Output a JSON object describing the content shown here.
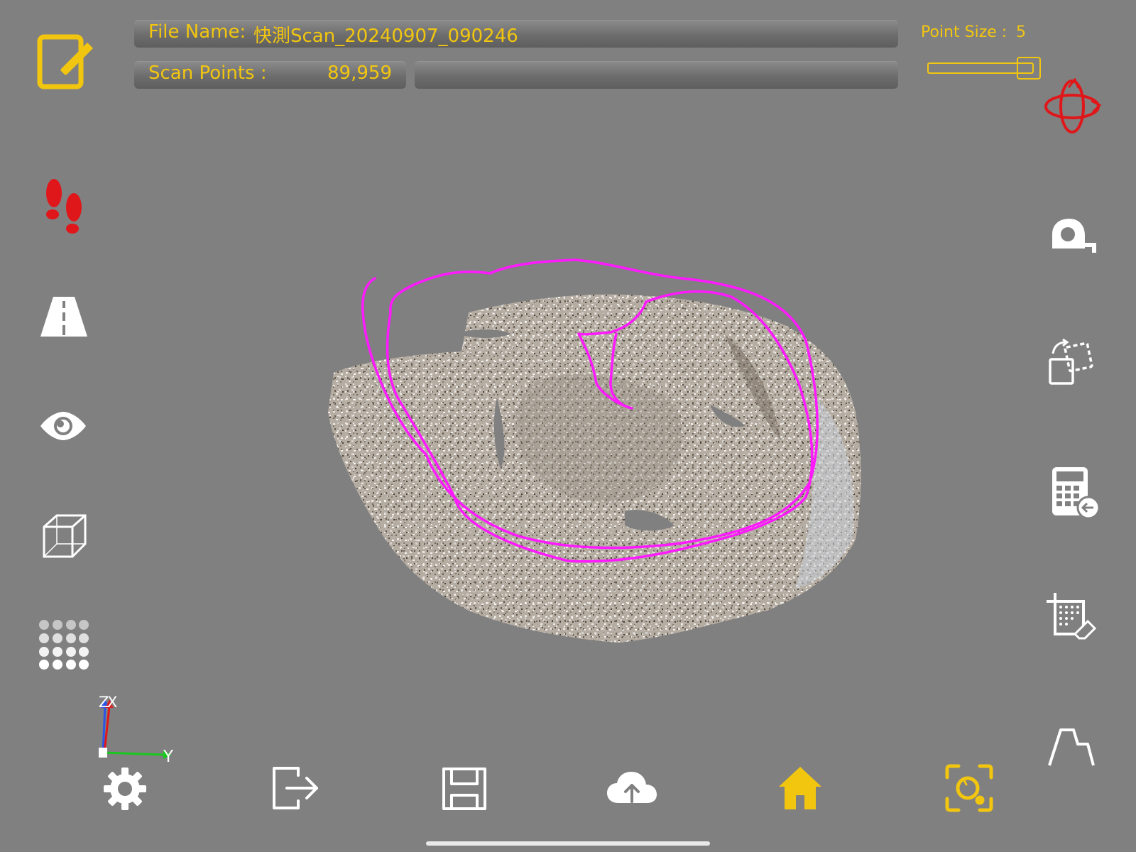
{
  "header": {
    "file_name_label": "File Name:",
    "file_name_value": "快測Scan_20240907_090246",
    "scan_points_label": "Scan Points :",
    "scan_points_value": "89,959"
  },
  "point_size": {
    "label": "Point Size :",
    "value": "5"
  },
  "axes": {
    "z_label": "Z",
    "x_label": "X",
    "y_label": "Y"
  },
  "colors": {
    "accent": "#f2c60f",
    "background": "#808080",
    "path": "#ff19ff",
    "orbit": "#e0171a"
  },
  "icons": {
    "left": [
      "edit-icon",
      "footprints-icon",
      "road-icon",
      "eye-icon",
      "wireframe-cube-icon",
      "dot-grid-icon"
    ],
    "right": [
      "orbit-icon",
      "tape-measure-icon",
      "transform-icon",
      "calculator-icon",
      "crop-erase-icon",
      "profile-icon"
    ],
    "bottom": [
      "settings-icon",
      "export-icon",
      "save-icon",
      "upload-cloud-icon",
      "home-icon",
      "scan-icon"
    ]
  }
}
